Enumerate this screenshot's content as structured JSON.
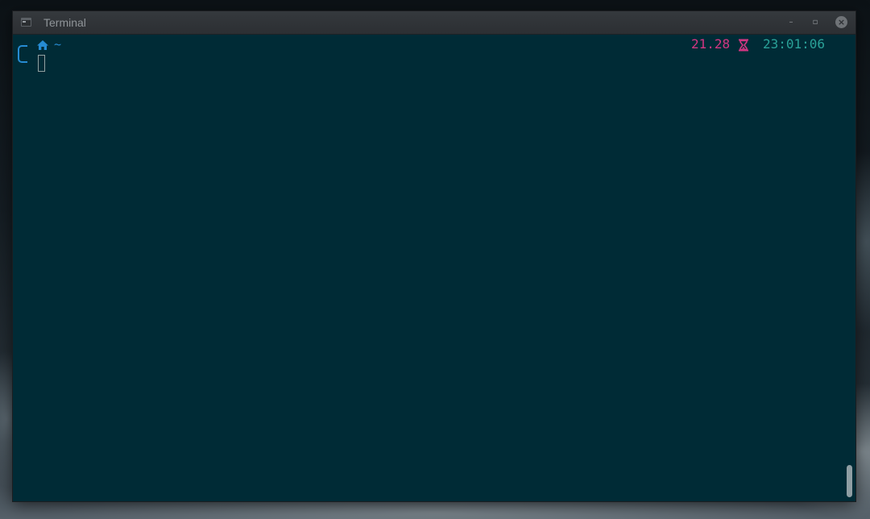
{
  "window": {
    "title": "Terminal",
    "icon": "terminal-icon",
    "buttons": {
      "minimize_icon": "minimize-icon",
      "maximize_icon": "maximize-icon",
      "close_icon": "close-icon"
    }
  },
  "terminal": {
    "prompt": {
      "location_icon": "home-icon",
      "cwd": "~",
      "duration": "21.28",
      "duration_icon": "hourglass-icon",
      "clock": "23:01:06"
    },
    "colors": {
      "background": "#002b36",
      "path": "#268bd2",
      "duration": "#d33682",
      "clock": "#2aa198"
    }
  }
}
